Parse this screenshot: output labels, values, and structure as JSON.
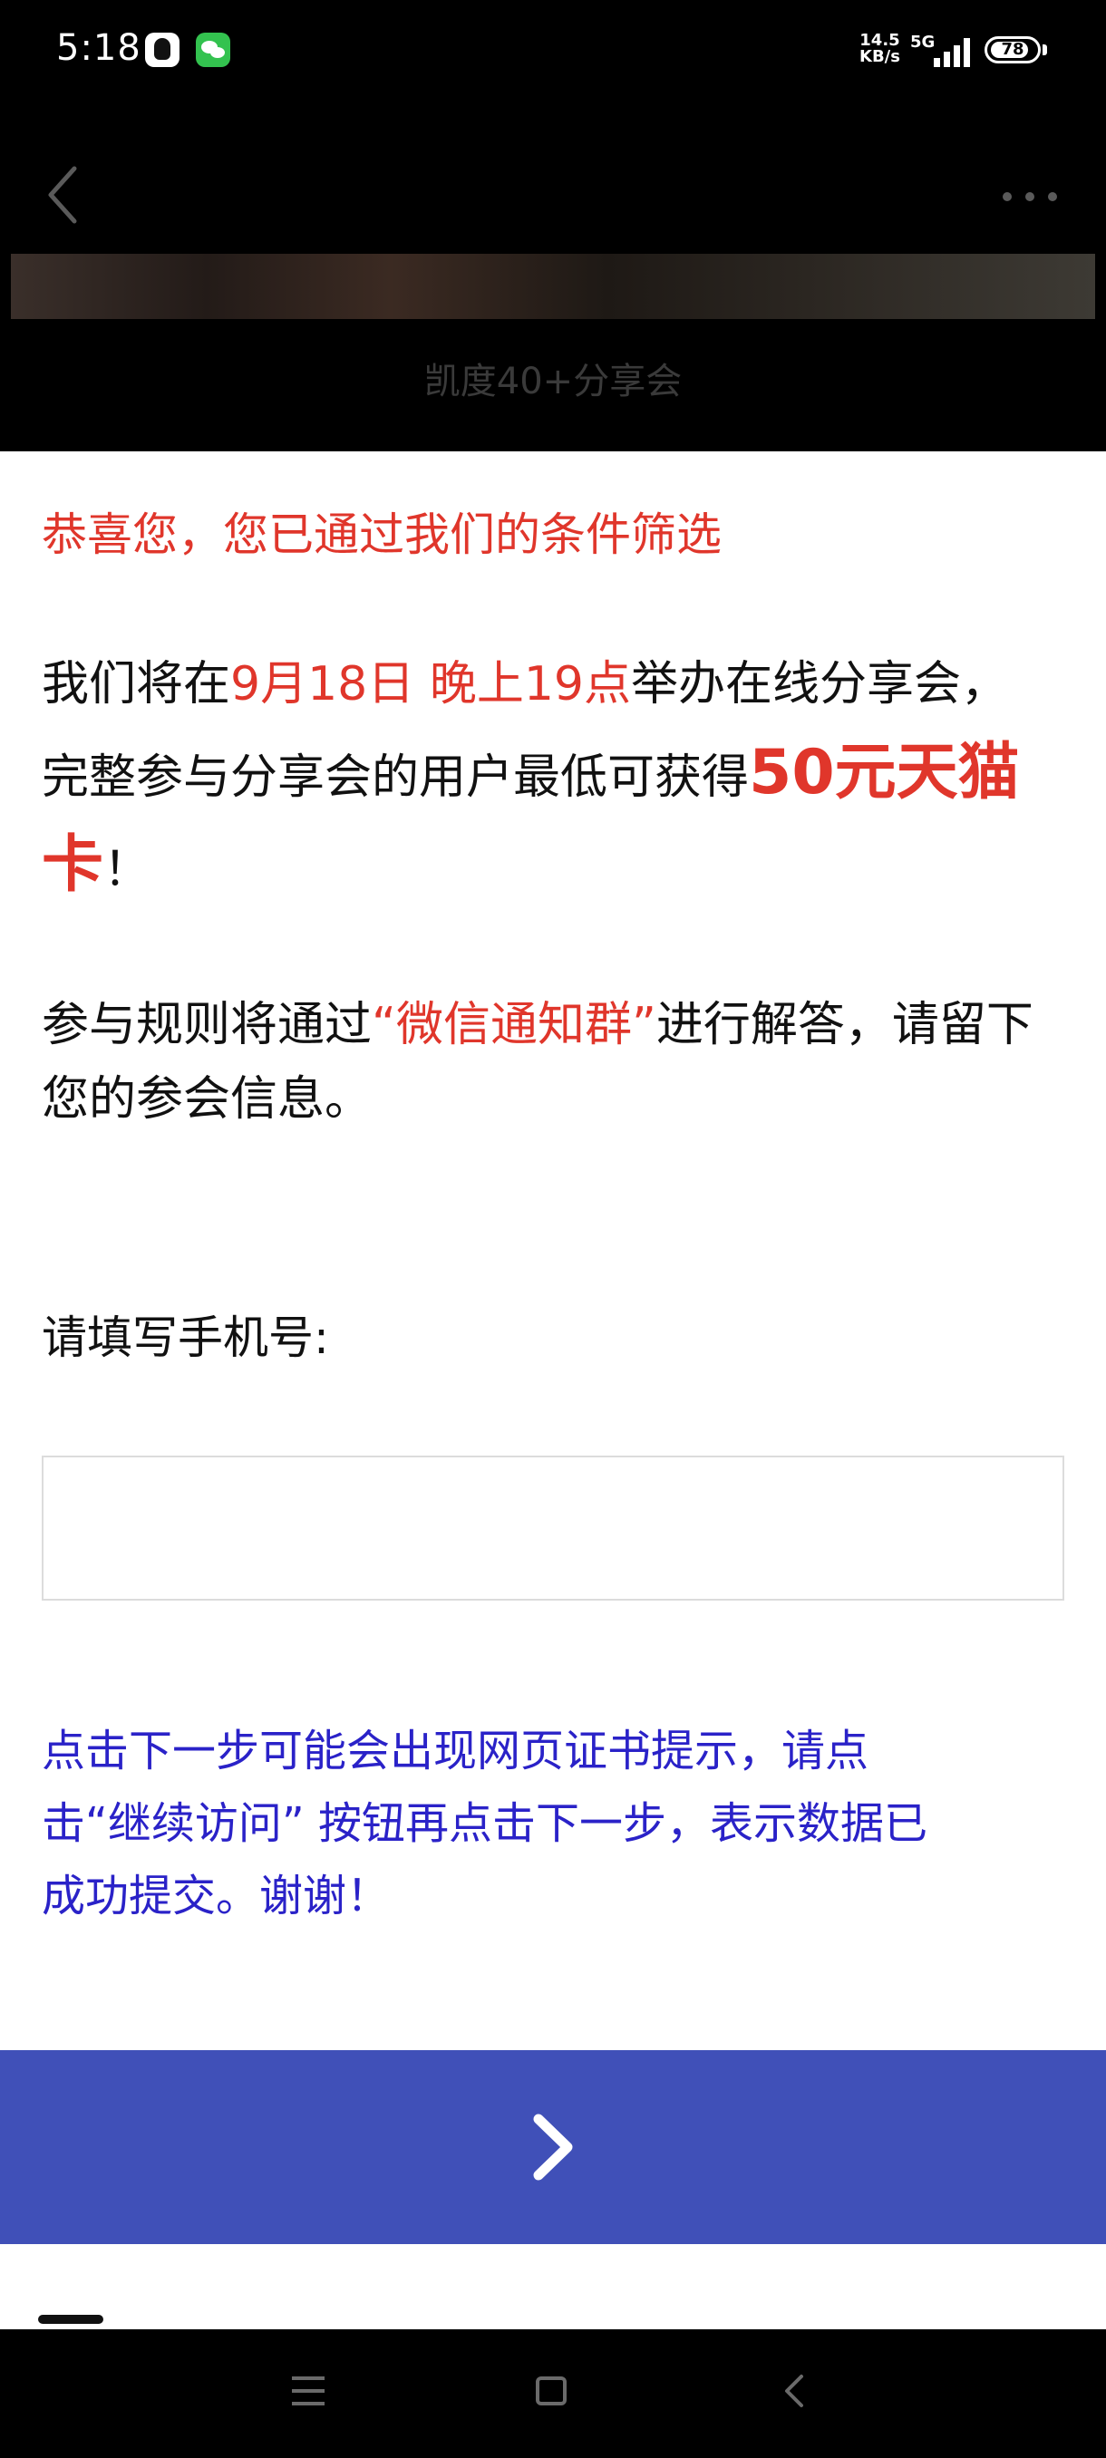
{
  "status_bar": {
    "time": "5:18",
    "net_speed_value": "14.5",
    "net_speed_unit": "KB/s",
    "network_type": "5G",
    "battery_level": "78",
    "icons": [
      "qq-icon",
      "wechat-icon",
      "signal-icon",
      "battery-icon"
    ]
  },
  "header": {
    "title": "凯度40+分享会",
    "back_icon": "chevron-left-icon",
    "more_icon": "more-dots-icon"
  },
  "content": {
    "congrats": "恭喜您，您已通过我们的条件筛选",
    "line1_prefix": "我们将在",
    "line1_date": "9月18日",
    "line1_time": "晚上19点",
    "line1_suffix": "举办在线分享会，",
    "line2_prefix": "完整参与分享会的用户最低可获得",
    "reward_part1": "50元天猫",
    "reward_part2": "卡",
    "line3_suffix": "！",
    "rule_prefix": "参与规则将通过",
    "rule_highlight": "“微信通知群”",
    "rule_suffix": "进行解答，请留下",
    "rule_line2": "您的参会信息。",
    "phone_label": "请填写手机号:",
    "phone_value": "",
    "notice_line1": "点击下一步可能会出现网页证书提示，请点",
    "notice_line2": "击“继续访问” 按钮再点击下一步，表示数据已",
    "notice_line3": "成功提交。谢谢！"
  },
  "next_button": {
    "icon": "chevron-right-icon",
    "color": "#4050b8"
  },
  "nav_bar": {
    "icons": [
      "menu-icon",
      "home-square-icon",
      "back-triangle-icon"
    ]
  },
  "colors": {
    "highlight_red": "#e0362b",
    "notice_blue": "#2a22c8"
  }
}
